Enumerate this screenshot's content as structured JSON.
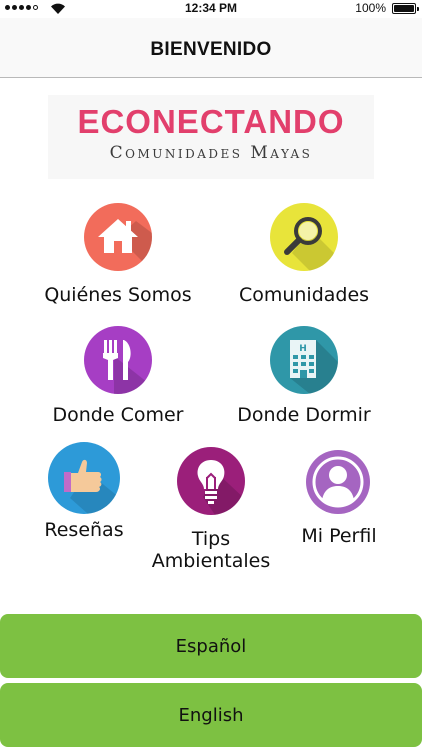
{
  "status_bar": {
    "time": "12:34 PM",
    "battery_percent": "100%",
    "signal_bars": 5,
    "signal_filled": 4
  },
  "nav": {
    "title": "BIENVENIDO"
  },
  "logo": {
    "title": "ECONECTANDO",
    "subtitle": "Comunidades Mayas",
    "title_color": "#e23f6c"
  },
  "menu": {
    "about": {
      "label": "Quiénes Somos",
      "icon": "house-icon",
      "color": "#f26c5b"
    },
    "communities": {
      "label": "Comunidades",
      "icon": "magnifier-icon",
      "color": "#e8e43a"
    },
    "eat": {
      "label": "Donde Comer",
      "icon": "fork-knife-icon",
      "color": "#a63ec4"
    },
    "sleep": {
      "label": "Donde Dormir",
      "icon": "hotel-icon",
      "color": "#2f97a8"
    },
    "reviews": {
      "label": "Reseñas",
      "icon": "thumbs-up-icon",
      "color": "#2d9ad8"
    },
    "tips": {
      "label_line1": "Tips",
      "label_line2": "Ambientales",
      "icon": "lightbulb-icon",
      "color": "#9b1f7a"
    },
    "profile": {
      "label": "Mi Perfil",
      "icon": "user-icon",
      "color": "#a565c1"
    }
  },
  "buttons": {
    "spanish": "Español",
    "english": "English",
    "color": "#7dc142"
  }
}
